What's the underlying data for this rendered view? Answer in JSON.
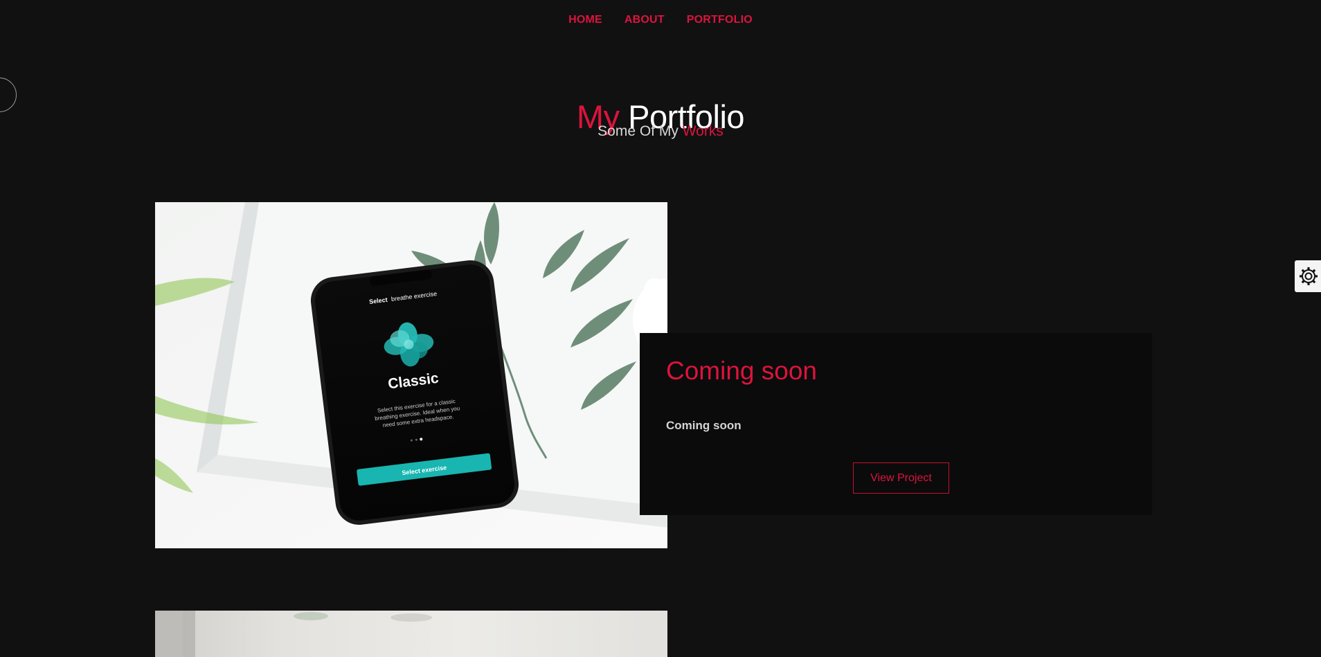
{
  "nav": {
    "items": [
      "HOME",
      "ABOUT",
      "PORTFOLIO"
    ]
  },
  "header": {
    "title_accent": "My",
    "title_main": "Portfolio",
    "subtitle_main": "Some Of My",
    "subtitle_accent": "Works"
  },
  "project": {
    "title": "Coming soon",
    "description": "Coming soon",
    "button_label": "View Project",
    "image": {
      "phone_header_bold": "Select",
      "phone_header_rest": "breathe exercise",
      "phone_title": "Classic",
      "phone_desc_1": "Select this exercise for a classic",
      "phone_desc_2": "breathing exercise. Ideal when you",
      "phone_desc_3": "need some extra headspace.",
      "phone_button": "Select exercise"
    }
  },
  "settings": {
    "icon": "gear-icon"
  },
  "colors": {
    "accent": "#dc143c",
    "background": "#111112",
    "card": "#0b0b0c",
    "teal": "#19b5b0"
  }
}
